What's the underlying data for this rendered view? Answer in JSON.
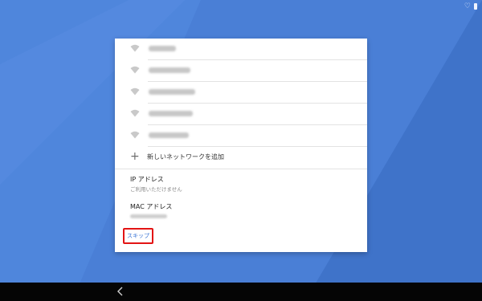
{
  "status_bar": {
    "icons": [
      "heart-icon",
      "battery-icon"
    ]
  },
  "wifi_list": {
    "networks": [
      {
        "ssid_hidden": true
      },
      {
        "ssid_hidden": true
      },
      {
        "ssid_hidden": true
      },
      {
        "ssid_hidden": true
      },
      {
        "ssid_hidden": true
      }
    ]
  },
  "add_network": {
    "label": "新しいネットワークを追加",
    "icon": "plus-icon"
  },
  "ip_address": {
    "title": "IP アドレス",
    "value": "ご利用いただけません"
  },
  "mac_address": {
    "title": "MAC アドレス"
  },
  "skip": {
    "label": "スキップ"
  },
  "nav": {
    "back_icon": "back-chevron-icon"
  },
  "colors": {
    "background": "#4a7fd6",
    "accent": "#3a74d6",
    "highlight": "#e31414"
  }
}
